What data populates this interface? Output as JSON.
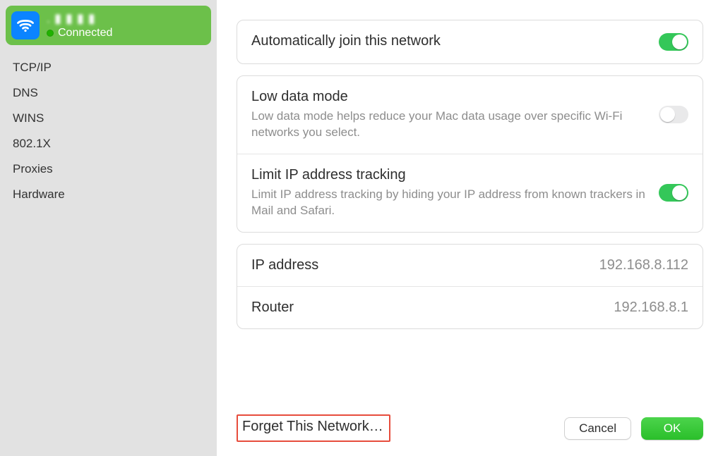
{
  "sidebar": {
    "network": {
      "name": " . ▮ ▮ ▮ ▮",
      "status": "Connected"
    },
    "items": [
      {
        "label": "TCP/IP"
      },
      {
        "label": "DNS"
      },
      {
        "label": "WINS"
      },
      {
        "label": "802.1X"
      },
      {
        "label": "Proxies"
      },
      {
        "label": "Hardware"
      }
    ]
  },
  "settings": {
    "auto_join": {
      "title": "Automatically join this network",
      "on": true
    },
    "low_data": {
      "title": "Low data mode",
      "desc": "Low data mode helps reduce your Mac data usage over specific Wi-Fi networks you select.",
      "on": false
    },
    "limit_ip": {
      "title": "Limit IP address tracking",
      "desc": "Limit IP address tracking by hiding your IP address from known trackers in Mail and Safari.",
      "on": true
    },
    "ip": {
      "title": "IP address",
      "value": "192.168.8.112"
    },
    "router": {
      "title": "Router",
      "value": "192.168.8.1"
    }
  },
  "footer": {
    "forget": "Forget This Network…",
    "cancel": "Cancel",
    "ok": "OK"
  }
}
